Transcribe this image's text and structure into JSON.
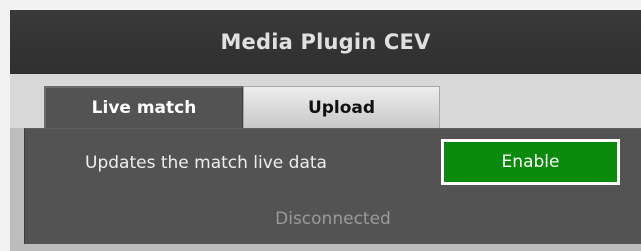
{
  "window": {
    "title": "Media Plugin CEV"
  },
  "tabs": [
    {
      "label": "Live match",
      "active": true
    },
    {
      "label": "Upload",
      "active": false
    }
  ],
  "live_match": {
    "description": "Updates the match live data",
    "enable_label": "Enable",
    "status": "Disconnected"
  },
  "colors": {
    "title_bar": "#333333",
    "panel": "#535353",
    "enable_button": "#0a8a0a",
    "status_text": "#9a9a9a"
  }
}
